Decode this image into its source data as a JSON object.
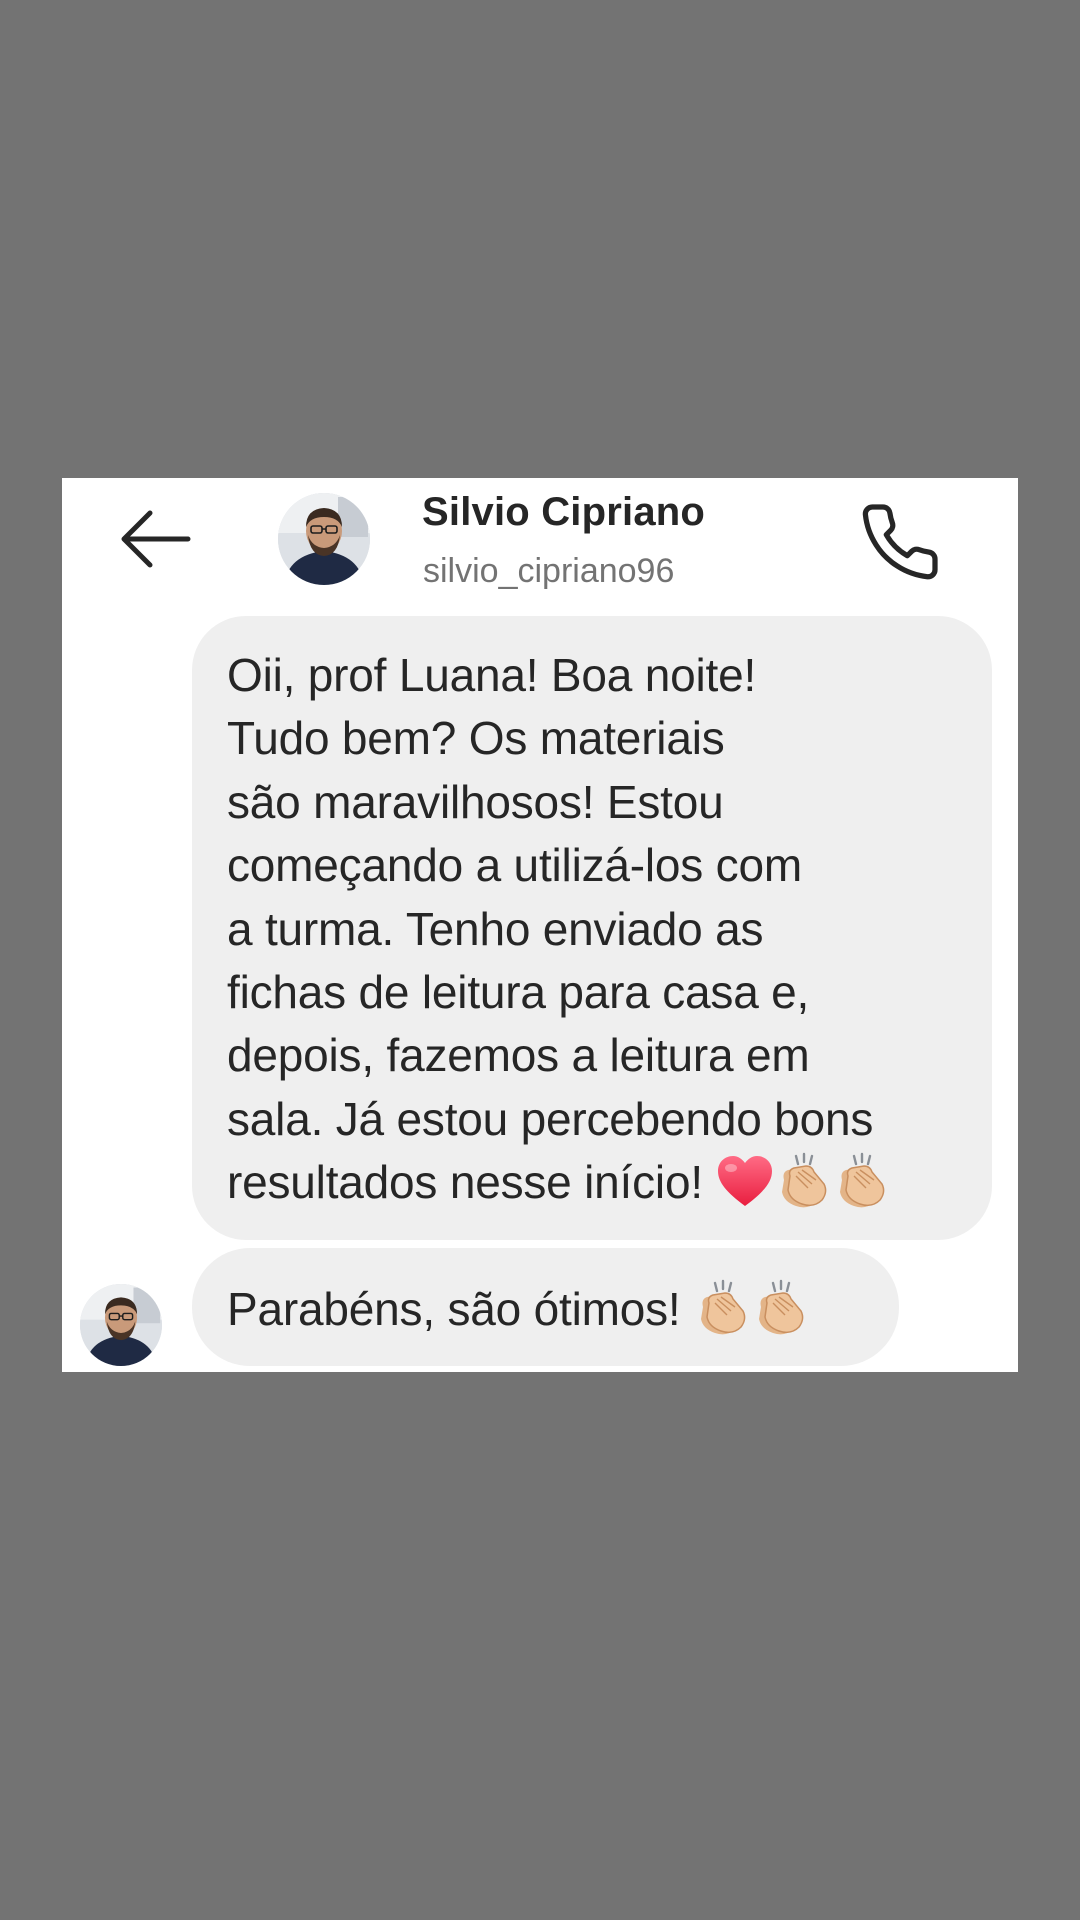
{
  "header": {
    "contact_name": "Silvio Cipriano",
    "contact_handle": "silvio_cipriano96",
    "back_icon": "arrow-left-icon",
    "call_icon": "phone-icon"
  },
  "messages": [
    {
      "sender": "them",
      "text": "Oii, prof Luana! Boa noite!\nTudo bem? Os materiais\nsão maravilhosos! Estou\ncomeçando a utilizá-los com\na turma. Tenho enviado as\nfichas de leitura para casa e,\ndepois, fazemos a leitura em\nsala. Já estou percebendo bons\nresultados nesse início! ",
      "emojis": [
        "heart-emoji",
        "clapping-hands-emoji",
        "clapping-hands-emoji"
      ]
    },
    {
      "sender": "them",
      "text": "Parabéns, são ótimos! ",
      "emojis": [
        "clapping-hands-emoji",
        "clapping-hands-emoji"
      ]
    }
  ],
  "colors": {
    "page_background": "#737373",
    "card_background": "#ffffff",
    "bubble_background": "#efefef",
    "text_primary": "#262626",
    "text_secondary": "#737373",
    "heart": "#f2415a",
    "clap": "#e8b98a"
  }
}
